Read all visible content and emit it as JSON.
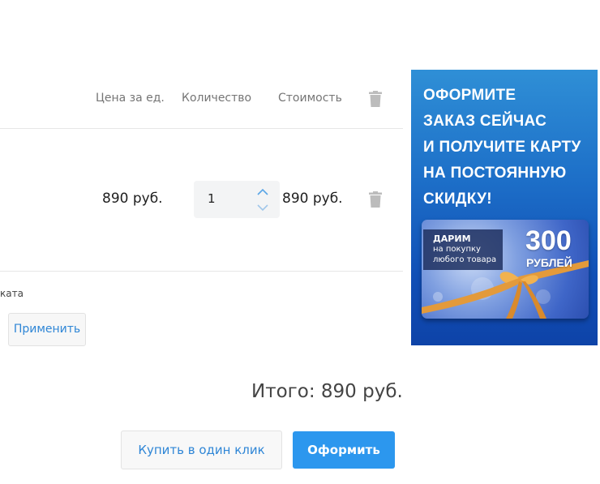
{
  "table": {
    "headers": {
      "unit_price": "Цена за ед.",
      "quantity": "Количество",
      "cost": "Стоимость"
    },
    "rows": [
      {
        "unit_price": "890 руб.",
        "quantity": "1",
        "cost": "890 руб."
      }
    ]
  },
  "coupon": {
    "label_fragment": "ката",
    "apply_label": "Применить"
  },
  "total": {
    "text": "Итого: 890 руб."
  },
  "actions": {
    "one_click_label": "Купить в один клик",
    "checkout_label": "Оформить"
  },
  "banner": {
    "lines": [
      "ОФОРМИТЕ",
      "ЗАКАЗ СЕЙЧАС",
      "И ПОЛУЧИТЕ КАРТУ",
      "НА ПОСТОЯННУЮ",
      "СКИДКУ!"
    ],
    "card": {
      "tag_line1": "ДАРИМ",
      "tag_line2": "на покупку",
      "tag_line3": "любого товара",
      "amount": "300",
      "unit": "РУБЛЕЙ"
    }
  },
  "icons": {
    "delete": "trash-icon",
    "increase": "chevron-up-icon",
    "decrease": "chevron-down-icon"
  },
  "colors": {
    "accent": "#2c97ee",
    "link": "#2f86d6",
    "banner": "#1d6fc8"
  }
}
